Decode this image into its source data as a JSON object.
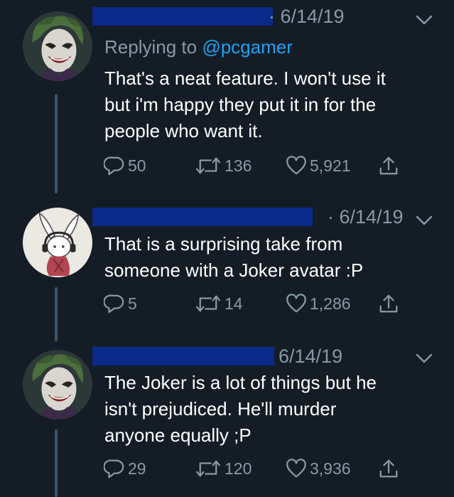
{
  "tweets": [
    {
      "date": "· 6/14/19",
      "replying_prefix": "Replying to ",
      "replying_handle": "@pcgamer",
      "text": "That's a neat feature. I won't use it\nbut i'm happy they put it in for the\npeople who want it.",
      "replies": "50",
      "retweets": "136",
      "likes": "5,921",
      "avatar": "joker-avatar"
    },
    {
      "date": "· 6/14/19",
      "text": "That is a surprising take from\nsomeone with a Joker avatar :P",
      "replies": "5",
      "retweets": "14",
      "likes": "1,286",
      "avatar": "bunny-avatar"
    },
    {
      "date": "6/14/19",
      "text": "The Joker is a lot of things but he\nisn't prejudiced. He'll murder\nanyone equally ;P",
      "replies": "29",
      "retweets": "120",
      "likes": "3,936",
      "avatar": "joker-avatar"
    }
  ],
  "colors": {
    "background": "#141d26",
    "muted": "#8899a6",
    "link": "#1da1f2",
    "thread_line": "#3d5466",
    "redaction": "#0a2a8a"
  },
  "icons": [
    "reply-icon",
    "retweet-icon",
    "like-icon",
    "share-icon",
    "chevron-down-icon"
  ]
}
